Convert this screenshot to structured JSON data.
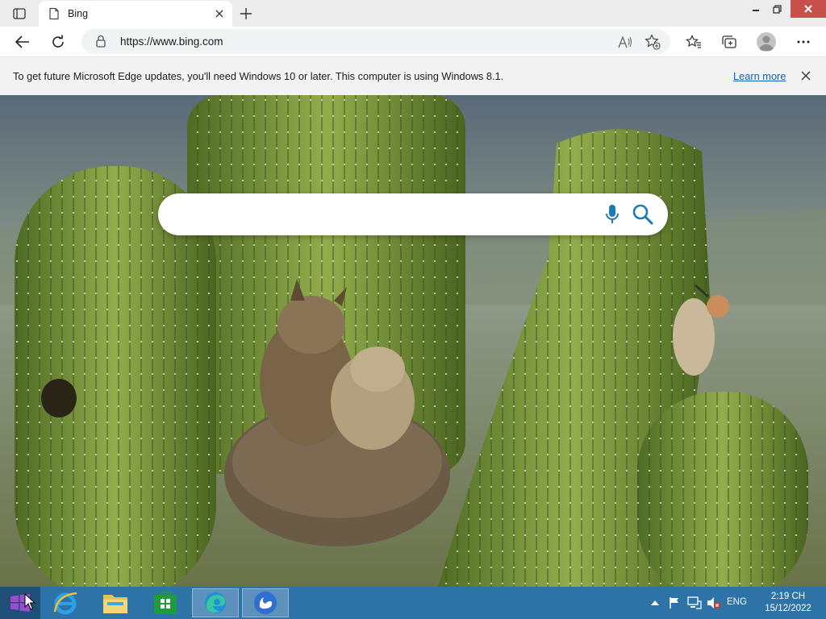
{
  "tabbar": {
    "tab_title": "Bing"
  },
  "toolbar": {
    "url": "https://www.bing.com"
  },
  "infobar": {
    "message": "To get future Microsoft Edge updates, you'll need Windows 10 or later. This computer is using Windows 8.1.",
    "learn_more": "Learn more"
  },
  "search": {
    "placeholder": ""
  },
  "taskbar": {
    "apps": [
      "internet-explorer",
      "file-explorer",
      "store",
      "microsoft-edge",
      "uc-browser"
    ],
    "language": "ENG",
    "time": "2:19 CH",
    "date": "15/12/2022"
  },
  "colors": {
    "taskbar": "#2d73a8",
    "start": "#1f4e79",
    "link": "#0f5fb5",
    "bing_icon": "#1c7bb5"
  }
}
